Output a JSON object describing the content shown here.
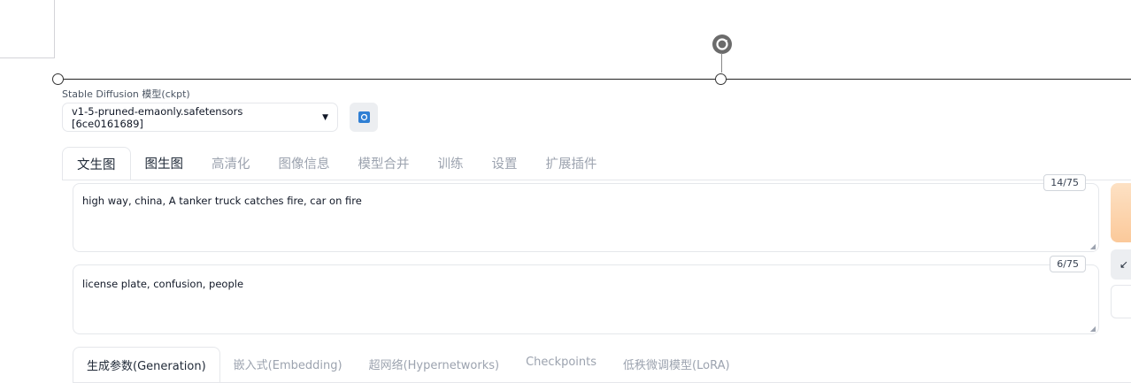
{
  "model": {
    "label": "Stable Diffusion 模型(ckpt)",
    "selected": "v1-5-pruned-emaonly.safetensors [6ce0161689]"
  },
  "icons": {
    "refresh": "refresh-icon",
    "rotate": "rotate-icon",
    "caret": "chevron-down-icon"
  },
  "tabs": [
    {
      "label": "文生图"
    },
    {
      "label": "图生图"
    },
    {
      "label": "高清化"
    },
    {
      "label": "图像信息"
    },
    {
      "label": "模型合并"
    },
    {
      "label": "训练"
    },
    {
      "label": "设置"
    },
    {
      "label": "扩展插件"
    }
  ],
  "prompt": {
    "value": "high way, china, A tanker truck catches fire, car on fire",
    "counter": "14/75"
  },
  "negative_prompt": {
    "value": "license plate, confusion, people",
    "counter": "6/75"
  },
  "side_button_glyph": "↙",
  "subtabs": [
    {
      "label": "生成参数(Generation)"
    },
    {
      "label": "嵌入式(Embedding)"
    },
    {
      "label": "超网络(Hypernetworks)"
    },
    {
      "label": "Checkpoints"
    },
    {
      "label": "低秩微调模型(LoRA)"
    }
  ],
  "colors": {
    "accent_blue": "#2f7fd4",
    "generate_orange": "#fbc99a"
  }
}
